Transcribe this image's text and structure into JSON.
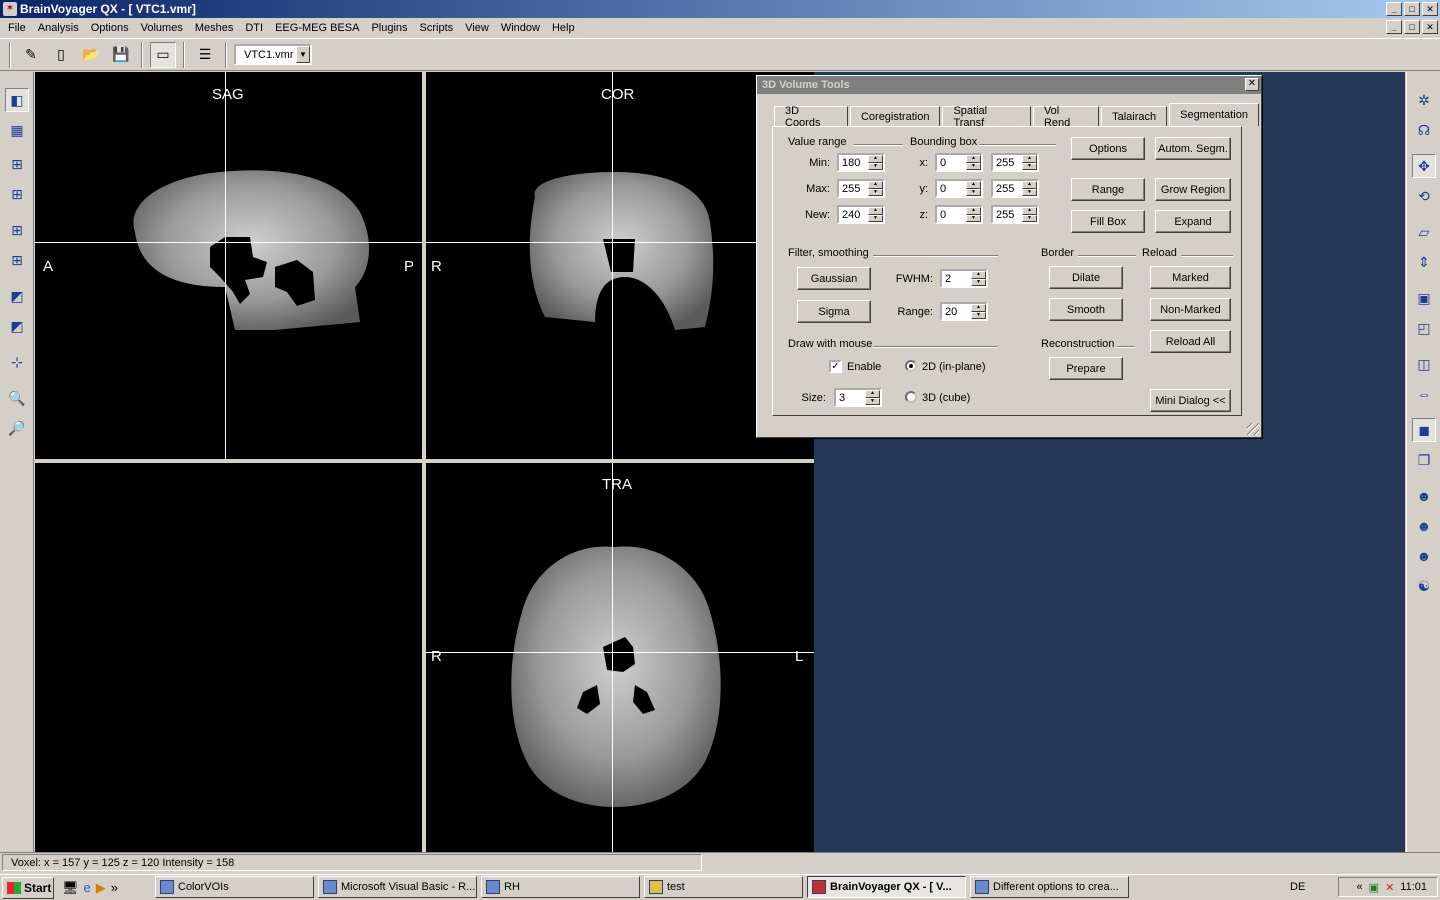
{
  "window": {
    "title": "BrainVoyager QX - [ VTC1.vmr]",
    "minimize": "_",
    "maximize": "□",
    "close": "✕"
  },
  "menu": [
    "File",
    "Analysis",
    "Options",
    "Volumes",
    "Meshes",
    "DTI",
    "EEG-MEG BESA",
    "Plugins",
    "Scripts",
    "View",
    "Window",
    "Help"
  ],
  "toolbar": {
    "file_combo": "VTC1.vmr"
  },
  "views": {
    "sag_label": "SAG",
    "cor_label": "COR",
    "tra_label": "TRA",
    "sag_left": "A",
    "sag_right": "P",
    "cor_left": "R",
    "tra_left": "R",
    "tra_right": "L"
  },
  "dialog": {
    "title": "3D Volume Tools",
    "close": "✕",
    "tabs": [
      "3D Coords",
      "Coregistration",
      "Spatial Transf",
      "Vol Rend",
      "Talairach",
      "Segmentation"
    ],
    "active_tab": "Segmentation",
    "value_range": {
      "title": "Value range",
      "min_label": "Min:",
      "min": "180",
      "max_label": "Max:",
      "max": "255",
      "new_label": "New:",
      "new": "240"
    },
    "bounding_box": {
      "title": "Bounding box",
      "x_label": "x:",
      "x_from": "0",
      "x_to": "255",
      "y_label": "y:",
      "y_from": "0",
      "y_to": "255",
      "z_label": "z:",
      "z_from": "0",
      "z_to": "255"
    },
    "buttons": {
      "options": "Options",
      "autom_segm": "Autom. Segm.",
      "range": "Range",
      "grow_region": "Grow Region",
      "fill_box": "Fill Box",
      "expand": "Expand",
      "gaussian": "Gaussian",
      "sigma": "Sigma",
      "dilate": "Dilate",
      "smooth": "Smooth",
      "marked": "Marked",
      "non_marked": "Non-Marked",
      "reload_all": "Reload All",
      "prepare": "Prepare",
      "mini_dialog": "Mini Dialog <<"
    },
    "filter": {
      "title": "Filter, smoothing",
      "fwhm_label": "FWHM:",
      "fwhm": "2",
      "range_label": "Range:",
      "range": "20"
    },
    "border_title": "Border",
    "reload_title": "Reload",
    "reconstruction_title": "Reconstruction",
    "draw": {
      "title": "Draw with mouse",
      "enable": "Enable",
      "enable_checked": true,
      "mode_2d": "2D (in-plane)",
      "mode_3d": "3D (cube)",
      "size_label": "Size:",
      "size": "3"
    }
  },
  "status": {
    "voxel": "Voxel:  x = 157 y = 125 z = 120  Intensity = 158"
  },
  "taskbar": {
    "start": "Start",
    "quicklaunch_more": "»",
    "tasks": [
      {
        "label": "ColorVOIs",
        "active": false
      },
      {
        "label": "Microsoft Visual Basic - R...",
        "active": false
      },
      {
        "label": "RH",
        "active": false
      },
      {
        "label": "test",
        "active": false
      },
      {
        "label": "BrainVoyager QX - [ V...",
        "active": true
      },
      {
        "label": "Different options to crea...",
        "active": false
      }
    ],
    "lang": "DE",
    "tray_expand": "«",
    "clock": "11:01"
  }
}
